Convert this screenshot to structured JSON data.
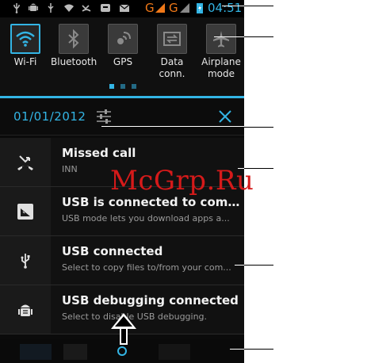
{
  "status_bar": {
    "network_left": "G",
    "network_right": "G",
    "time": "04:51",
    "icons": [
      "usb-icon",
      "android-debug-icon",
      "usb-icon",
      "wifi-question-icon",
      "missed-call-icon",
      "bbm-icon",
      "email-icon",
      "signal-icon",
      "signal-icon",
      "battery-charging-icon"
    ]
  },
  "quick_settings": {
    "tiles": [
      {
        "label": "Wi-Fi",
        "icon": "wifi-icon",
        "active": true
      },
      {
        "label": "Bluetooth",
        "icon": "bluetooth-icon",
        "active": false
      },
      {
        "label": "GPS",
        "icon": "gps-icon",
        "active": false
      },
      {
        "label_line1": "Data",
        "label_line2": "conn.",
        "icon": "data-connection-icon",
        "active": false
      },
      {
        "label_line1": "Airplane",
        "label_line2": "mode",
        "icon": "airplane-icon",
        "active": false
      }
    ],
    "pages": 3
  },
  "date_row": {
    "date": "01/01/2012",
    "settings_icon": "sliders-icon",
    "clear_icon": "close-icon"
  },
  "notifications": [
    {
      "title": "Missed call",
      "subtitle": "INN",
      "icon": "missed-call-icon"
    },
    {
      "title": "USB is connected to comp...",
      "subtitle": "USB mode lets you download apps a...",
      "icon": "usb-storage-icon"
    },
    {
      "title": "USB connected",
      "subtitle": "Select to copy files to/from your com...",
      "icon": "usb-icon"
    },
    {
      "title": "USB debugging connected",
      "subtitle": "Select to disable USB debugging.",
      "icon": "android-debug-icon"
    }
  ],
  "watermark": "McGrp.Ru",
  "colors": {
    "accent": "#33b5e5",
    "network_orange": "#f07818",
    "watermark_red": "#d61a1a"
  }
}
